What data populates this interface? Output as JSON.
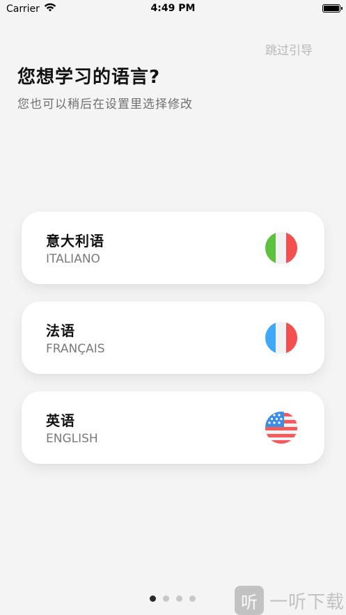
{
  "status_bar": {
    "carrier": "Carrier",
    "time": "4:49 PM",
    "battery_level": 1.0
  },
  "header": {
    "skip_label": "跳过引导",
    "title": "您想学习的语言?",
    "subtitle": "您也可以稍后在设置里选择修改"
  },
  "languages": [
    {
      "name": "意大利语",
      "native": "ITALIANO",
      "flag": "italy-flag-icon"
    },
    {
      "name": "法语",
      "native": "FRANÇAIS",
      "flag": "france-flag-icon"
    },
    {
      "name": "英语",
      "native": "ENGLISH",
      "flag": "usa-flag-icon"
    }
  ],
  "pagination": {
    "total": 4,
    "current": 1
  },
  "watermark": {
    "icon_glyph": "听",
    "text": "一听下载"
  },
  "colors": {
    "background": "#f4f4f4",
    "italy_green": "#5cc13f",
    "italy_red": "#f55050",
    "france_blue": "#40a9f7",
    "france_red": "#f55050",
    "usa_red": "#f55a5a",
    "usa_blue": "#3a8ee8"
  }
}
